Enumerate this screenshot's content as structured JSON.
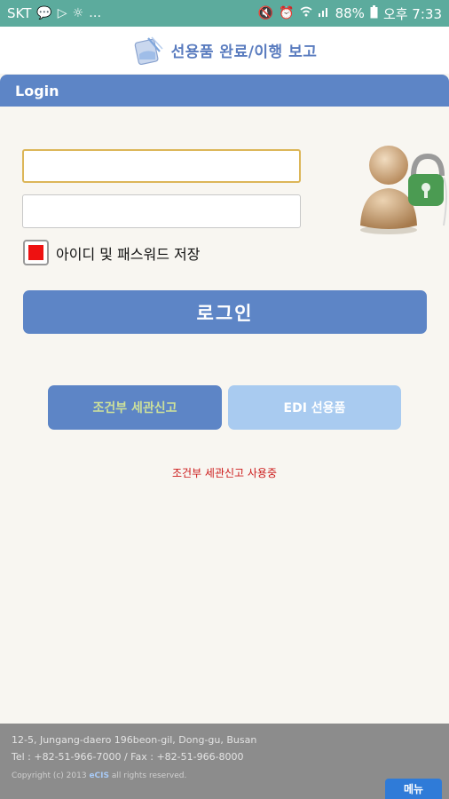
{
  "status_bar": {
    "carrier": "SKT",
    "battery": "88%",
    "time": "오후 7:33",
    "icons": [
      "chat-icon",
      "play-store-icon",
      "brightness-icon",
      "more-icon",
      "mute-icon",
      "alarm-icon",
      "wifi-icon",
      "signal-icon",
      "battery-icon"
    ]
  },
  "header": {
    "title": "선용품 완료/이행 보고"
  },
  "login_section": {
    "heading": "Login"
  },
  "form": {
    "id_value": "",
    "pw_value": "",
    "remember_label": "아이디 및 패스워드 저장",
    "remember_checked": true,
    "login_button": "로그인"
  },
  "buttons": {
    "conditional": "조건부 세관신고",
    "edi": "EDI 선용품"
  },
  "status_message": "조건부 세관신고 사용중",
  "footer": {
    "address": "12-5, Jungang-daero 196beon-gil, Dong-gu, Busan",
    "contact": "Tel : +82-51-966-7000 / Fax : +82-51-966-8000",
    "copyright_prefix": "Copyright (c) 2013",
    "brand": "eCIS",
    "copyright_suffix": "all rights reserved.",
    "menu_button": "메뉴"
  },
  "colors": {
    "status_bar": "#5cab9d",
    "primary": "#5d85c6",
    "secondary": "#a9cbf0",
    "alert": "#cc1a1a",
    "checkbox_fill": "#ee1111",
    "footer": "#8c8c8c",
    "menu": "#2f7bd8"
  }
}
